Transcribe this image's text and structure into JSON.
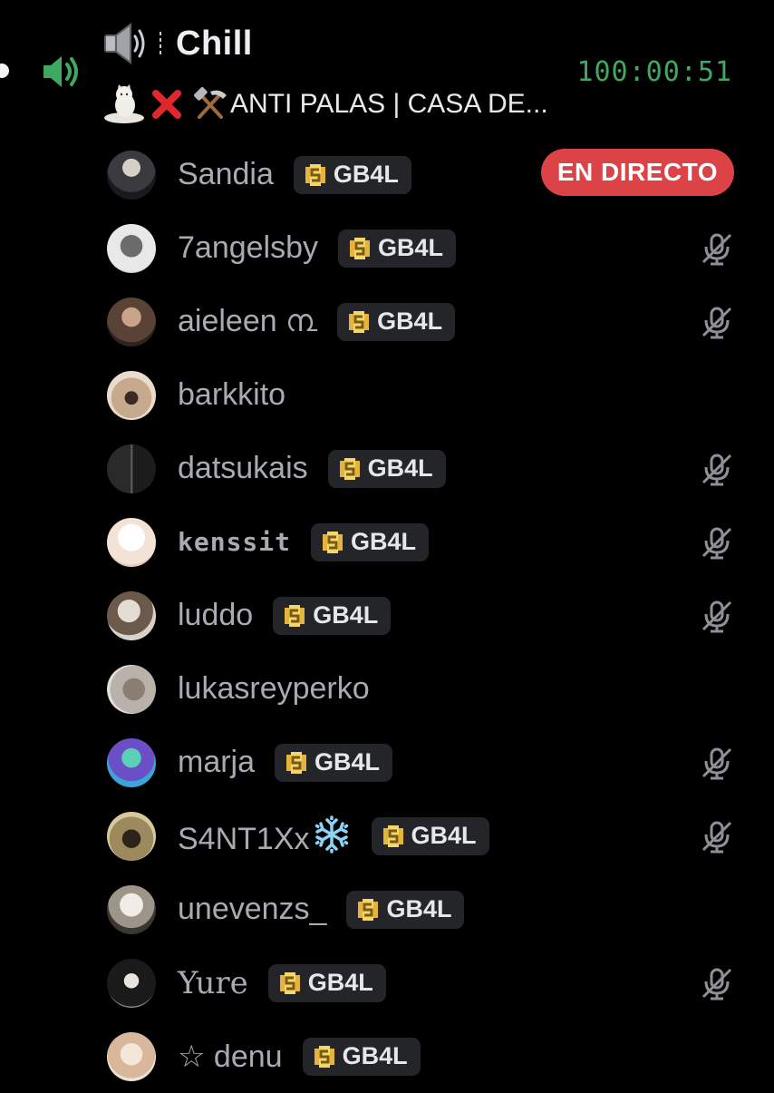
{
  "channel": {
    "name": "Chill",
    "status_text": "ANTI PALAS | CASA DE...",
    "elapsed": "100:00:51",
    "speaker_color": "#3fa95f"
  },
  "colors": {
    "background": "#000000",
    "live_badge": "#dc4347",
    "tag_background": "#242528",
    "timer": "#3fa95f"
  },
  "live_label": "EN DIRECTO",
  "members": [
    {
      "name": "Sandia",
      "tag": "GB4L",
      "live": true,
      "muted": false
    },
    {
      "name": "7angelsby",
      "tag": "GB4L",
      "live": false,
      "muted": true
    },
    {
      "name": "aieleen ൩",
      "tag": "GB4L",
      "live": false,
      "muted": true
    },
    {
      "name": "barkkito",
      "tag": "",
      "live": false,
      "muted": false
    },
    {
      "name": "datsukais",
      "tag": "GB4L",
      "live": false,
      "muted": true
    },
    {
      "name": "kenssit",
      "tag": "GB4L",
      "live": false,
      "muted": true
    },
    {
      "name": "luddo",
      "tag": "GB4L",
      "live": false,
      "muted": true
    },
    {
      "name": "lukasreyperko",
      "tag": "",
      "live": false,
      "muted": false
    },
    {
      "name": "marja",
      "tag": "GB4L",
      "live": false,
      "muted": true
    },
    {
      "name": "S4NT1Xx",
      "tag": "GB4L",
      "live": false,
      "muted": true
    },
    {
      "name": "unevenzs_",
      "tag": "GB4L",
      "live": false,
      "muted": false
    },
    {
      "name": "Yure",
      "tag": "GB4L",
      "live": false,
      "muted": true
    },
    {
      "name": "☆ denu",
      "tag": "GB4L",
      "live": false,
      "muted": false
    }
  ],
  "icons": {
    "channel": "speaker-icon",
    "voice_active": "volume-icon",
    "tag": "coin-icon",
    "muted": "mic-muted-icon",
    "status": [
      "cat-sticker-icon",
      "red-x-icon",
      "pick-hammer-icon"
    ]
  }
}
